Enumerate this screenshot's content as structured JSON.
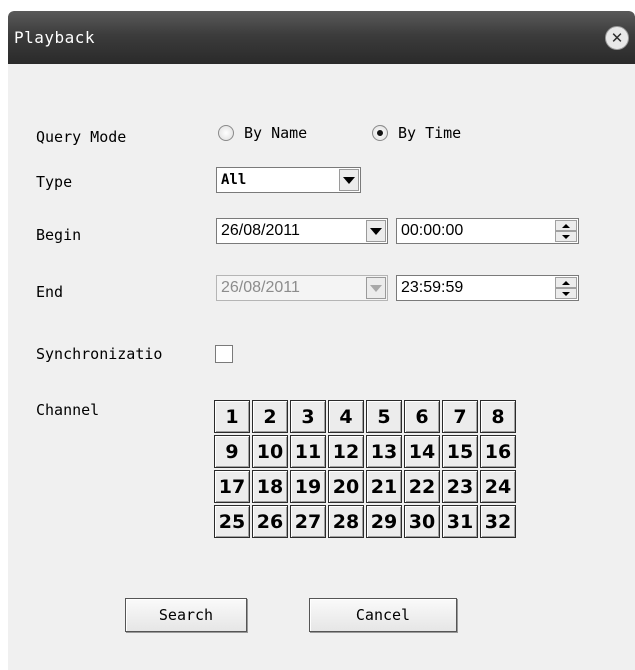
{
  "dialog": {
    "title": "Playback",
    "close_glyph": "✕"
  },
  "query_mode": {
    "label": "Query Mode",
    "options": [
      {
        "label": "By Name",
        "checked": false
      },
      {
        "label": "By Time",
        "checked": true
      }
    ]
  },
  "type": {
    "label": "Type",
    "value": "All"
  },
  "begin": {
    "label": "Begin",
    "date": "26/08/2011",
    "time": "00:00:00"
  },
  "end": {
    "label": "End",
    "date": "26/08/2011",
    "time": "23:59:59",
    "date_disabled": true
  },
  "sync": {
    "label": "Synchronizatio",
    "checked": false
  },
  "channel": {
    "label": "Channel",
    "numbers": [
      "1",
      "2",
      "3",
      "4",
      "5",
      "6",
      "7",
      "8",
      "9",
      "10",
      "11",
      "12",
      "13",
      "14",
      "15",
      "16",
      "17",
      "18",
      "19",
      "20",
      "21",
      "22",
      "23",
      "24",
      "25",
      "26",
      "27",
      "28",
      "29",
      "30",
      "31",
      "32"
    ]
  },
  "buttons": {
    "search": "Search",
    "cancel": "Cancel"
  }
}
